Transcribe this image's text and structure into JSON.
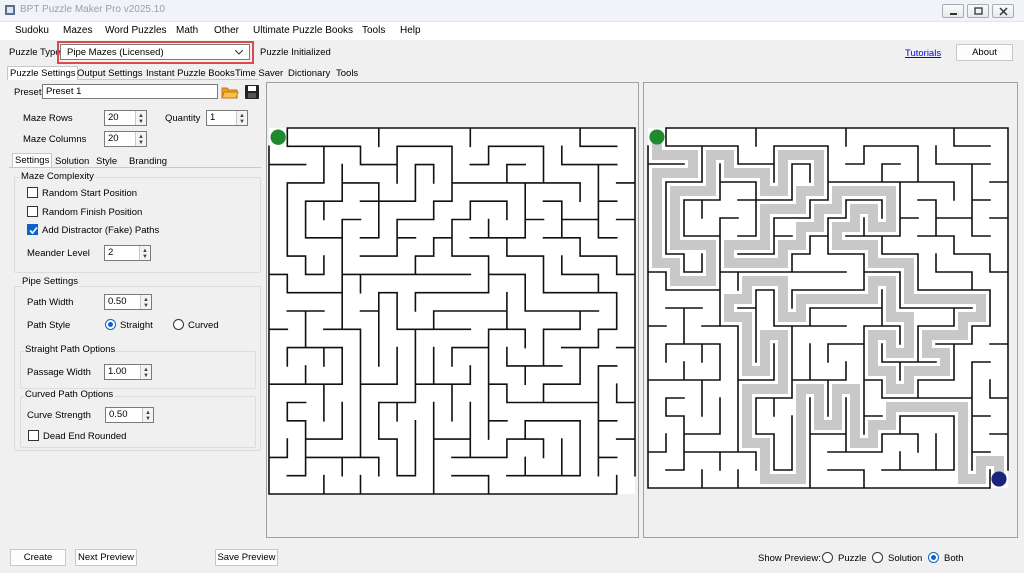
{
  "window": {
    "title": "BPT Puzzle Maker Pro v2025.10"
  },
  "menu": [
    "Sudoku",
    "Mazes",
    "Word Puzzles",
    "Math",
    "Other",
    "Ultimate Puzzle Books",
    "Tools",
    "Help"
  ],
  "puzzle_type": {
    "label": "Puzzle Type",
    "value": "Pipe Mazes (Licensed)",
    "status": "Puzzle Initialized"
  },
  "top_right": {
    "tutorials": "Tutorials",
    "about": "About"
  },
  "main_tabs": [
    "Puzzle Settings",
    "Output Settings",
    "Instant Puzzle Books",
    "Time Saver",
    "Dictionary",
    "Tools"
  ],
  "preset": {
    "label": "Preset",
    "value": "Preset 1"
  },
  "maze": {
    "rows_label": "Maze Rows",
    "rows": "20",
    "cols_label": "Maze Columns",
    "cols": "20",
    "qty_label": "Quantity",
    "qty": "1"
  },
  "sub_tabs": [
    "Settings",
    "Solution",
    "Style",
    "Branding"
  ],
  "complexity": {
    "title": "Maze Complexity",
    "random_start": "Random Start Position",
    "random_finish": "Random Finish Position",
    "distractor": "Add Distractor (Fake) Paths",
    "meander_label": "Meander Level",
    "meander": "2"
  },
  "pipe": {
    "title": "Pipe Settings",
    "path_width_label": "Path Width",
    "path_width": "0.50",
    "path_style_label": "Path Style",
    "straight": "Straight",
    "curved": "Curved",
    "straight_title": "Straight Path Options",
    "passage_label": "Passage Width",
    "passage": "1.00",
    "curved_title": "Curved Path Options",
    "curve_label": "Curve Strength",
    "curve": "0.50",
    "dead_end": "Dead End Rounded"
  },
  "bottom": {
    "create": "Create",
    "next": "Next Preview",
    "save": "Save Preview",
    "show_label": "Show Preview:",
    "opt_puzzle": "Puzzle",
    "opt_solution": "Solution",
    "opt_both": "Both"
  },
  "colors": {
    "accent": "#0a64c8",
    "highlight": "#e0484f",
    "start": "#1f8a2b",
    "finish": "#1a237e",
    "solution": "#c8c8c8"
  }
}
